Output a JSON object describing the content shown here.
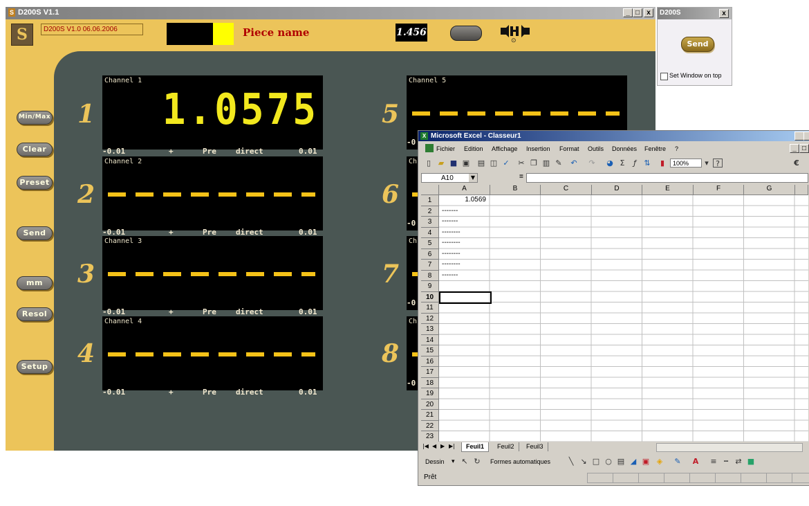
{
  "d200s": {
    "title": "D200S V1.1",
    "logo_glyph": "S",
    "version_text": "D200S V1.0 06.06.2006",
    "piece_name": "Piece name",
    "value_box": "1.456",
    "icon_dot": "⊙",
    "win_buttons": [
      "_",
      "□",
      "x"
    ],
    "side_buttons": [
      "Min/Max",
      "Clear",
      "Preset",
      "Send",
      "mm",
      "Resol",
      "Setup"
    ],
    "channels": [
      {
        "number": "1",
        "label": "Channel 1",
        "value": "1.0575",
        "low": "-0.01",
        "sign": "+",
        "mode": "Pre",
        "type": "direct",
        "high": "0.01"
      },
      {
        "number": "2",
        "label": "Channel 2",
        "value": "",
        "low": "-0.01",
        "sign": "+",
        "mode": "Pre",
        "type": "direct",
        "high": "0.01"
      },
      {
        "number": "3",
        "label": "Channel 3",
        "value": "",
        "low": "-0.01",
        "sign": "+",
        "mode": "Pre",
        "type": "direct",
        "high": "0.01"
      },
      {
        "number": "4",
        "label": "Channel 4",
        "value": "",
        "low": "-0.01",
        "sign": "+",
        "mode": "Pre",
        "type": "direct",
        "high": "0.01"
      },
      {
        "number": "5",
        "label": "Channel 5",
        "value": "",
        "low": "-0"
      },
      {
        "number": "6",
        "label": "Ch",
        "value": "",
        "low": "-0"
      },
      {
        "number": "7",
        "label": "Ch",
        "value": "",
        "low": "-0"
      },
      {
        "number": "8",
        "label": "Ch",
        "value": "",
        "low": "-0"
      }
    ]
  },
  "dialog": {
    "title": "D200S",
    "close": "x",
    "send_label": "Send",
    "checkbox_label": "Set Window on top"
  },
  "excel": {
    "title": "Microsoft Excel - Classeur1",
    "menu": [
      "Fichier",
      "Edition",
      "Affichage",
      "Insertion",
      "Format",
      "Outils",
      "Données",
      "Fenêtre",
      "?"
    ],
    "toolbar_icons": [
      "new-icon",
      "open-icon",
      "save-icon",
      "permission-icon",
      "print-icon",
      "preview-icon",
      "spell-icon",
      "cut-icon",
      "copy-icon",
      "paste-icon",
      "format-painter-icon",
      "undo-icon",
      "redo-icon",
      "hyperlink-icon",
      "autosum-icon",
      "function-icon",
      "sort-icon",
      "chart-icon"
    ],
    "zoom": "100%",
    "help_glyph": "?",
    "euro": "€",
    "name_box": "A10",
    "formula_eq": "=",
    "columns": [
      "A",
      "B",
      "C",
      "D",
      "E",
      "F",
      "G"
    ],
    "rows": [
      "1",
      "2",
      "3",
      "4",
      "5",
      "6",
      "7",
      "8",
      "9",
      "10",
      "11",
      "12",
      "13",
      "14",
      "15",
      "16",
      "17",
      "18",
      "19",
      "20",
      "21",
      "22",
      "23"
    ],
    "cells_a": [
      "1.0569",
      "-------",
      "-------",
      "--------",
      "--------",
      "--------",
      "--------",
      "-------"
    ],
    "sheets": [
      "Feuil1",
      "Feuil2",
      "Feuil3"
    ],
    "draw_label": "Dessin",
    "shapes_label": "Formes automatiques",
    "status": "Prêt"
  }
}
